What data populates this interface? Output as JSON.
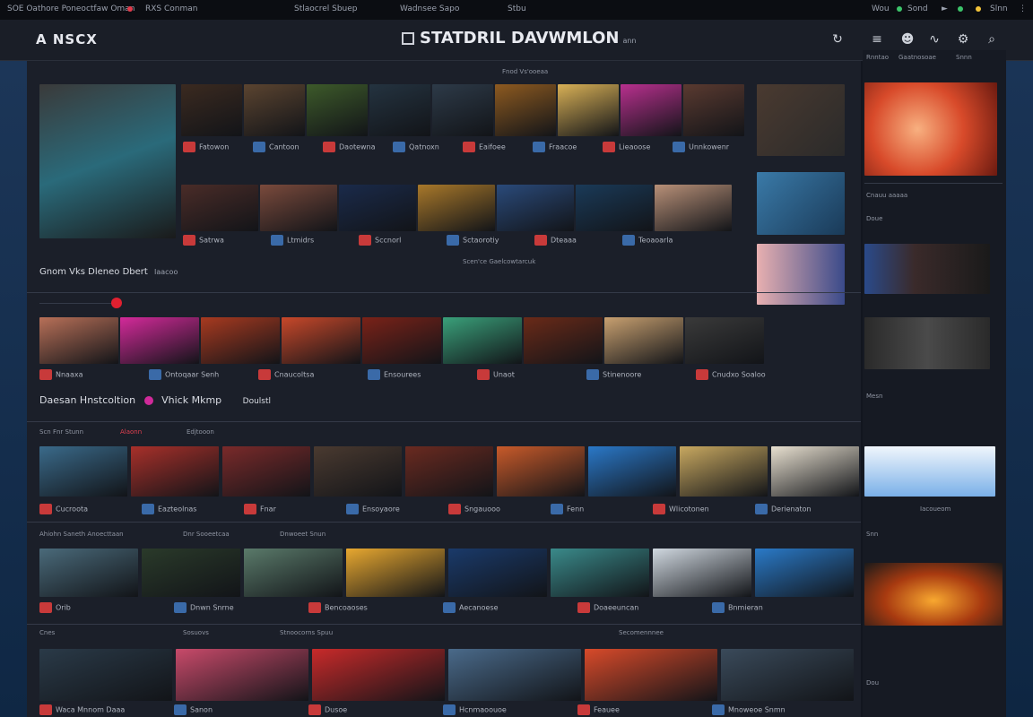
{
  "system_bar": {
    "left_text": "SOE Oathore Poneoctfaw Oman",
    "app_text": "RXS Conman",
    "item_a": "Stlaocrel Sbuep",
    "item_b": "Wadnsee Sapo",
    "item_c": "Stbu",
    "right_a": "Wou",
    "right_b": "Sond",
    "right_c": "Slnn",
    "colors": {
      "accent_red": "#e23a4a",
      "accent_green": "#3cc46a",
      "accent_yellow": "#f3c43a"
    }
  },
  "header": {
    "logo": "A NSCX",
    "title": "STATDRIL DAVWMLON",
    "title_sub": "ann",
    "icons": [
      "refresh-icon",
      "menu-icon",
      "user-icon",
      "chart-icon",
      "settings-icon",
      "search-icon"
    ],
    "icon_chars": [
      "↻",
      "≡",
      "☻",
      "∿",
      "⚙",
      "⌕"
    ]
  },
  "main": {
    "top_label": "Fnod Vs'ooeaa",
    "featured": {
      "captions": [
        "Fatowon",
        "Cantoon",
        "Daotewna",
        "Qatnoxn",
        "Eaifoee",
        "Fraacoe",
        "Lieaoose",
        "Unnkowenr"
      ],
      "row2_captions": [
        "Satrwa",
        "Ltmidrs",
        "Sccnorl",
        "Sctaorotiy",
        "Dteaaa",
        "Teoaoarla"
      ],
      "row1_colors": [
        "#3b2a20",
        "#5b4430",
        "#3d5a2a",
        "#243340",
        "#2d3a48",
        "#8d5a20",
        "#d8b056",
        "#b8308e",
        "#5a3a30"
      ],
      "row2_colors": [
        "#4a2c28",
        "#7a4a3c",
        "#1a2a4a",
        "#a8782a",
        "#2a4a7a",
        "#1a3a58",
        "#b89078"
      ],
      "hero_color": "#2a5a6a",
      "footer": "Scen'ce Gaelcowtarcuk"
    },
    "section1": {
      "title": "Gnom Vks Dleneo Dbert",
      "title_suffix": "Iaacoo"
    },
    "row_a": {
      "colors": [
        "#b87058",
        "#d42a9a",
        "#a83a20",
        "#c8482a",
        "#7a2218",
        "#3aa07a",
        "#6a2a18",
        "#c8a070",
        "#3a3a3a"
      ],
      "captions": [
        "Nnaaxa",
        "Ontoqaar Senh",
        "Cnaucoltsa",
        "Ensourees",
        "Unaot",
        "Stinenoore",
        "Cnudxo Soaloo"
      ]
    },
    "section2": {
      "title_a": "Daesan Hnstcoltion",
      "title_b": "Vhick Mkmp",
      "title_c": "Doulstl"
    },
    "row_b": {
      "label_a": "Scn Fnr Stunn",
      "label_b": "Alaonn",
      "label_c": "Edjtooon",
      "colors": [
        "#3a6a8a",
        "#a8302a",
        "#7a2a2a",
        "#4a3a30",
        "#6a2a20",
        "#c85a2a",
        "#2a78c8",
        "#c8a860",
        "#e8e0d0"
      ],
      "captions": [
        "Cucroota",
        "Eazteolnas",
        "Fnar",
        "Ensoyaore",
        "Sngauooo",
        "Fenn",
        "Wlicotonen",
        "Derienaton"
      ]
    },
    "row_c": {
      "label_a": "Ahiohn Saneth Anoecttaan",
      "label_b": "Dnr Sooeetcaa",
      "label_c": "Dnwoeet Snun",
      "colors": [
        "#4a6a7a",
        "#2a3a2a",
        "#5a7a6a",
        "#e8a830",
        "#1a3a6a",
        "#3a8a8a",
        "#d0d8e0",
        "#2a7ac8"
      ],
      "captions": [
        "Orib",
        "Dnwn Snrne",
        "Bencoaoses",
        "Aecanoese",
        "Doaeeuncan",
        "Bnmieran"
      ]
    },
    "row_d": {
      "label_a": "Cnes",
      "label_b": "Sosuovs",
      "label_c": "Stnoocorns Spuu",
      "label_d": "Secomennnee",
      "colors": [
        "#2a3a48",
        "#c84a6a",
        "#c82a2a",
        "#4a6a8a",
        "#d84a2a",
        "#3a4a5a"
      ],
      "captions": [
        "Waca Mnnom Daaa",
        "Sanon",
        "Dusoe",
        "Hcnmaoouoe",
        "Feauee",
        "Mnoweoe Snmn"
      ]
    }
  },
  "right_panel": {
    "tabs": [
      "Rnntao",
      "Gaatnosoae",
      "Snnn"
    ],
    "items": [
      "Cnauu aaaaa",
      "Doue",
      "Mesn",
      "Iacoueom",
      "Snn",
      "Dou"
    ],
    "colors": [
      "#e86a3a",
      "#2a4a8a",
      "#3a3a3a",
      "#d8e8f8",
      "#e8a030"
    ]
  }
}
